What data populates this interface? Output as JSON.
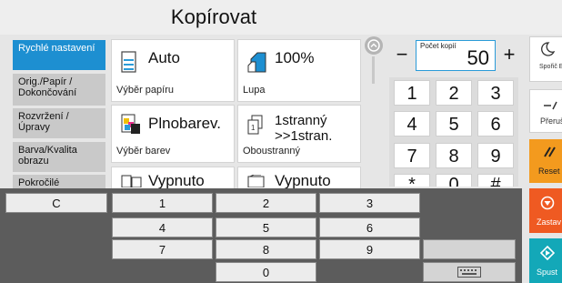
{
  "title": "Kopírovat",
  "nav": [
    {
      "label": "Rychlé nastavení"
    },
    {
      "label": "Orig./Papír / Dokončování"
    },
    {
      "label": "Rozvržení /Úpravy"
    },
    {
      "label": "Barva/Kvalita obrazu"
    },
    {
      "label": "Pokročilé"
    }
  ],
  "tiles": {
    "paper": {
      "value": "Auto",
      "label": "Výběr papíru"
    },
    "zoom": {
      "value": "100%",
      "label": "Lupa"
    },
    "color": {
      "value": "Plnobarev.",
      "label": "Výběr barev"
    },
    "duplex": {
      "value": "1stranný >>1stran.",
      "label": "Oboustranný"
    },
    "off1": {
      "value": "Vypnuto"
    },
    "off2": {
      "value": "Vypnuto"
    }
  },
  "counter": {
    "label": "Počet kopií",
    "value": "50",
    "minus": "−",
    "plus": "+"
  },
  "numpad": [
    "1",
    "2",
    "3",
    "4",
    "5",
    "6",
    "7",
    "8",
    "9",
    "*",
    "0",
    "#"
  ],
  "right": {
    "sleep": "Spořič En",
    "interrupt": "Přeruš",
    "reset": "Reset",
    "stop": "Zastav",
    "start": "Spust"
  },
  "keyboard": {
    "c": "C",
    "rows": [
      [
        "1",
        "2",
        "3"
      ],
      [
        "4",
        "5",
        "6"
      ],
      [
        "7",
        "8",
        "9"
      ],
      [
        "0"
      ]
    ]
  },
  "colors": {
    "accent": "#1d8fd1",
    "reset": "#f39a1e",
    "stop": "#ef5a22",
    "start": "#13a8b8"
  }
}
